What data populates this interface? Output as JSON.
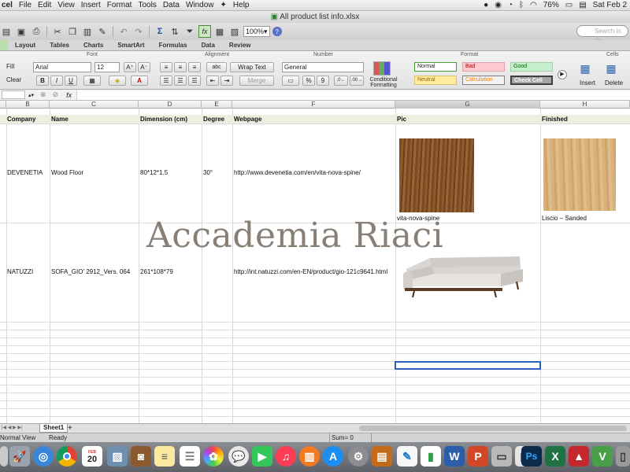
{
  "menubar": {
    "apple_icon": "apple-icon",
    "app_name": "cel",
    "items": [
      "File",
      "Edit",
      "View",
      "Insert",
      "Format",
      "Tools",
      "Data",
      "Window",
      "Help"
    ],
    "battery": "76%",
    "datetime": "Sat Feb 2"
  },
  "window": {
    "title": "All product list info.xlsx"
  },
  "toolbar": {
    "zoom": "100%",
    "search_placeholder": "Search in Sh"
  },
  "ribbon": {
    "tabs": [
      "Layout",
      "Tables",
      "Charts",
      "SmartArt",
      "Formulas",
      "Data",
      "Review"
    ],
    "groups": {
      "font": "Font",
      "alignment": "Alignment",
      "number": "Number",
      "format": "Format",
      "cells": "Cells"
    },
    "fill": "Fill",
    "clear": "Clear",
    "font_name": "Arial",
    "font_size": "12",
    "bold": "B",
    "italic": "I",
    "underline": "U",
    "abc": "abc",
    "wrap_text": "Wrap Text",
    "merge": "Merge",
    "number_format": "General",
    "percent": "%",
    "comma": "9",
    "conditional_formatting": "Conditional Formatting",
    "styles": {
      "normal": "Normal",
      "bad": "Bad",
      "good": "Good",
      "neutral": "Neutral",
      "calculation": "Calculation",
      "check_cell": "Check Cell"
    },
    "insert": "Insert",
    "delete": "Delete"
  },
  "formula_bar": {
    "fx": "fx",
    "content": ""
  },
  "columns": [
    "B",
    "C",
    "D",
    "E",
    "F",
    "G",
    "H"
  ],
  "headers": {
    "company": "Company",
    "name": "Name",
    "dimension": "Dimension (cm)",
    "degree": "Degree",
    "webpage": "Webpage",
    "pic": "Pic",
    "finished": "Finished"
  },
  "rows": [
    {
      "company": "DEVENETIA",
      "name": "Wood Floor",
      "dimension": "80*12*1.5",
      "degree": "30°",
      "webpage": "http://www.devenetia.com/en/vita-nova-spine/",
      "pic_caption": "vita-nova-spine",
      "finished_caption": "Liscio – Sanded"
    },
    {
      "company": "NATUZZI",
      "name": "SOFA_GIO' 2912_Vers. 064",
      "dimension": "261*108*79",
      "degree": "",
      "webpage": "http://int.natuzzi.com/en-EN/product/gio-121c9641.html",
      "pic_caption": "",
      "finished_caption": ""
    }
  ],
  "watermark": "Accademia Riaci",
  "sheets": [
    "Sheet1"
  ],
  "status": {
    "view": "Normal View",
    "ready": "Ready",
    "sum": "Sum= 0"
  },
  "dock": {
    "calendar_month": "FEB",
    "calendar_day": "20"
  },
  "colors": {
    "accent_green": "#bbe0b0",
    "selection": "#2d5fbf",
    "header_fill": "#eeeee0"
  }
}
